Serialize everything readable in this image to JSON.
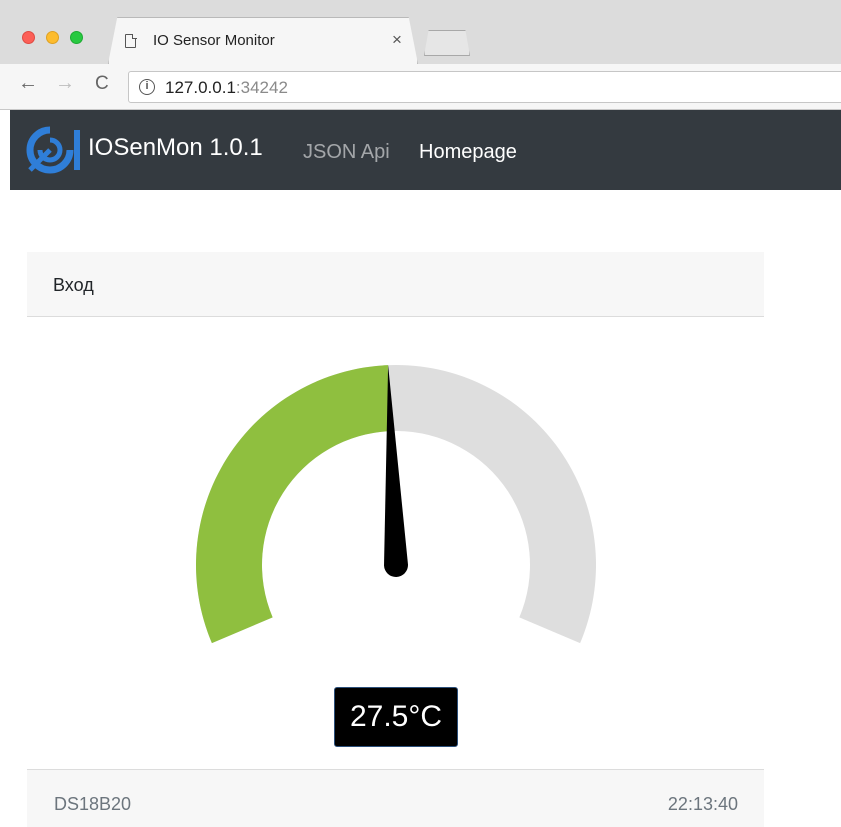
{
  "browser": {
    "tab_title": "IO Sensor Monitor",
    "tab_close": "×",
    "url_host": "127.0.0.1",
    "url_port": ":34242",
    "nav": {
      "back": "←",
      "forward": "→",
      "reload": "C"
    },
    "info_icon": "i"
  },
  "navbar": {
    "brand": "IOSenMon 1.0.1",
    "links": [
      {
        "label": "JSON Api"
      },
      {
        "label": "Homepage"
      }
    ],
    "accent": "#2f7ed8",
    "background": "#343a40"
  },
  "card": {
    "header": "Вход",
    "gauge": {
      "value_fraction": 0.49,
      "readout": "27.5°C",
      "colors": {
        "fill": "#8fbf3f",
        "track": "#dedede",
        "needle": "#000000"
      }
    },
    "footer": {
      "sensor": "DS18B20",
      "time": "22:13:40"
    }
  }
}
